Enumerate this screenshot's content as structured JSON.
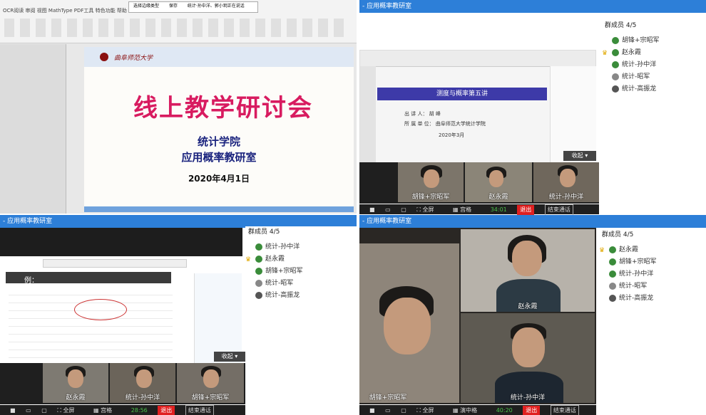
{
  "ppt": {
    "menu": "OCR阅读  审阅  视图  MathType  PDF工具  特色功能  帮助",
    "context_btns": [
      "选择边缘类型",
      "保存",
      "统计·孙中洋、郭小玥正在说话"
    ],
    "university": "曲阜师范大学",
    "title": "线上教学研讨会",
    "sub1": "统计学院",
    "sub2": "应用概率教研室",
    "date": "2020年4月1日"
  },
  "tr": {
    "window_title": "- 应用概率教研室",
    "slide_title": "测度与概率第五讲",
    "slide_line1": "出 讲 人：  胡 峰",
    "slide_line2": "所 属 单 位：  曲阜师范大学统计学院",
    "slide_date": "2020年3月",
    "collapse": "收起",
    "members_header": "群成员 4/5",
    "members": [
      "胡锋+宗昭军",
      "赵永霞",
      "统计-孙中洋",
      "统计-昭军",
      "统计-高振龙"
    ],
    "videos": [
      "胡锋+宗昭军",
      "赵永霞",
      "统计-孙中洋"
    ],
    "toolbar": {
      "fullscreen": "全屏",
      "gallery": "宫格",
      "timer": "34:01",
      "exit": "退出",
      "end": "结束通话"
    }
  },
  "bl": {
    "window_title": "- 应用概率教研室",
    "example": "例：",
    "collapse": "收起",
    "members_header": "群成员 4/5",
    "members": [
      "统计-孙中洋",
      "赵永霞",
      "胡锋+宗昭军",
      "统计-昭军",
      "统计-高振龙"
    ],
    "videos": [
      "赵永霞",
      "统计-孙中洋",
      "胡锋+宗昭军"
    ],
    "toolbar": {
      "fullscreen": "全屏",
      "gallery": "宫格",
      "timer": "28:56",
      "exit": "退出",
      "end": "结束通话"
    }
  },
  "br": {
    "window_title": "- 应用概率教研室",
    "members_header": "群成员 4/5",
    "members": [
      "赵永霞",
      "胡锋+宗昭军",
      "统计-孙中洋",
      "统计-昭军",
      "统计-高振龙"
    ],
    "videos": [
      "赵永霞",
      "胡锋+宗昭军",
      "统计-孙中洋"
    ],
    "toolbar": {
      "fullscreen": "全屏",
      "gallery": "演中格",
      "timer": "40:20",
      "exit": "退出",
      "end": "结束通话"
    }
  }
}
